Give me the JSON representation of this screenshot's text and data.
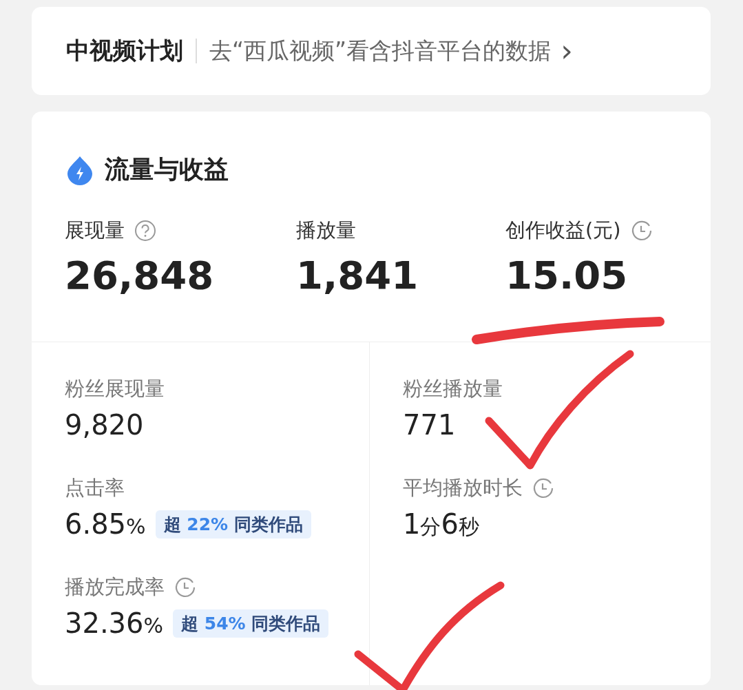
{
  "plan_banner": {
    "title": "中视频计划",
    "link": "去“西瓜视频”看含抖音平台的数据",
    "chevron": "›"
  },
  "section": {
    "title": "流量与收益",
    "metrics": [
      {
        "label": "展现量",
        "help": true,
        "value": "26,848"
      },
      {
        "label": "播放量",
        "value": "1,841"
      },
      {
        "label": "创作收益(元)",
        "timer": true,
        "value": "15.05"
      }
    ],
    "detail_columns": [
      [
        {
          "label": "粉丝展现量",
          "value_parts": [
            {
              "text": "9,820",
              "kind": "num"
            }
          ]
        },
        {
          "label": "点击率",
          "value_parts": [
            {
              "text": "6.85",
              "kind": "num"
            },
            {
              "text": "%",
              "kind": "unit"
            }
          ],
          "badge": {
            "prefix": "超",
            "percent": "22%",
            "suffix": "同类作品"
          }
        },
        {
          "label": "播放完成率",
          "timer": true,
          "value_parts": [
            {
              "text": "32.36",
              "kind": "num"
            },
            {
              "text": "%",
              "kind": "unit"
            }
          ],
          "badge": {
            "prefix": "超",
            "percent": "54%",
            "suffix": "同类作品"
          }
        }
      ],
      [
        {
          "label": "粉丝播放量",
          "value_parts": [
            {
              "text": "771",
              "kind": "num"
            }
          ]
        },
        {
          "label": "平均播放时长",
          "timer": true,
          "value_parts": [
            {
              "text": "1",
              "kind": "num"
            },
            {
              "text": "分",
              "kind": "unit"
            },
            {
              "text": "6",
              "kind": "num"
            },
            {
              "text": "秒",
              "kind": "unit"
            }
          ]
        }
      ]
    ]
  },
  "annotations": [
    {
      "kind": "underline"
    },
    {
      "kind": "check"
    },
    {
      "kind": "check"
    }
  ]
}
